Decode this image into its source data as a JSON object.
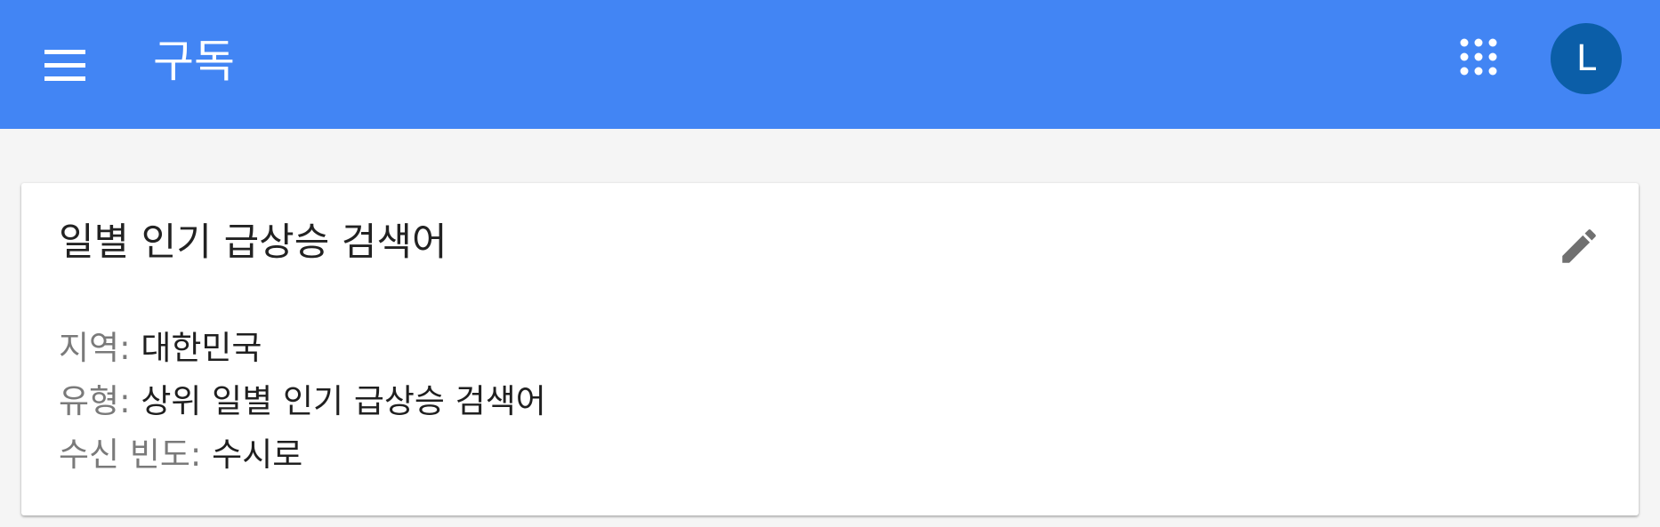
{
  "appbar": {
    "title": "구독",
    "menu_icon": "hamburger-menu-icon",
    "apps_icon": "apps-grid-icon",
    "avatar_letter": "L",
    "color": "#4285f4",
    "avatar_color": "#0b5ea8"
  },
  "subscription": {
    "title": "일별 인기 급상승 검색어",
    "edit_icon": "pencil-icon",
    "details": [
      {
        "label": "지역:",
        "value": "대한민국"
      },
      {
        "label": "유형:",
        "value": "상위 일별 인기 급상승 검색어"
      },
      {
        "label": "수신 빈도:",
        "value": "수시로"
      }
    ]
  }
}
